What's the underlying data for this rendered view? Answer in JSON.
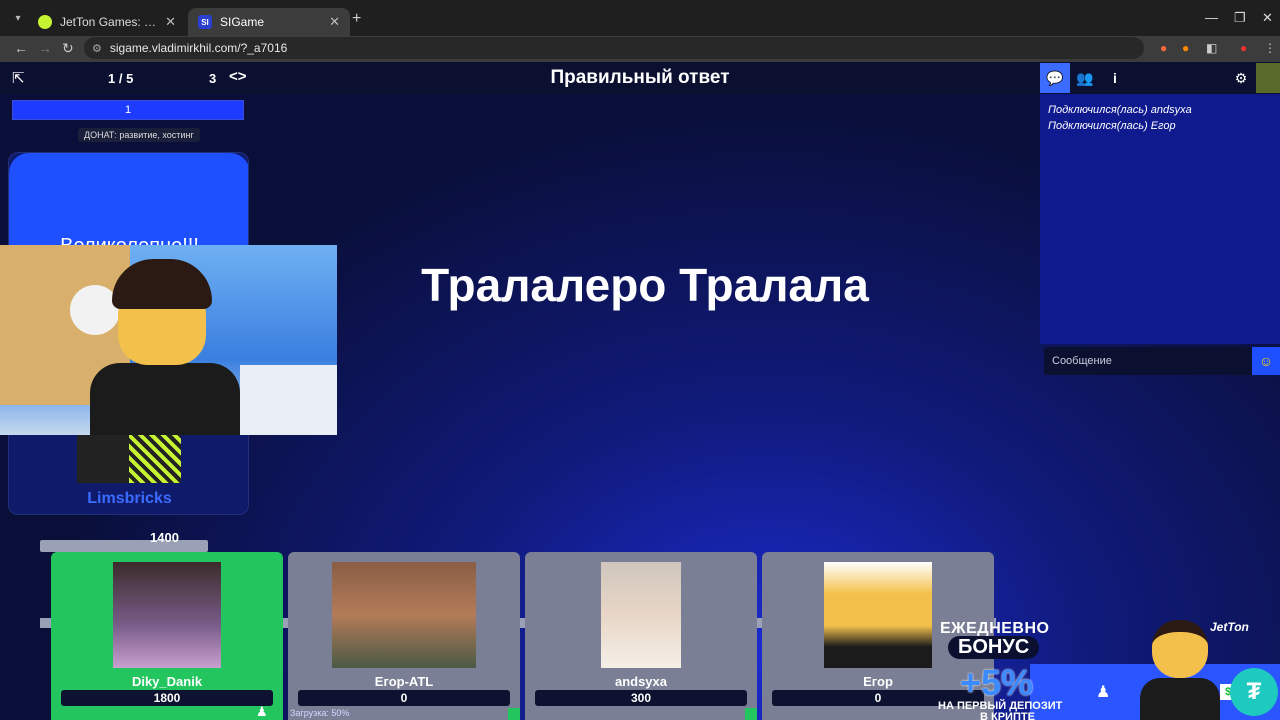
{
  "browser": {
    "tabs": [
      {
        "title": "JetTon Games: Погружение в",
        "active": false
      },
      {
        "title": "SIGame",
        "active": true
      }
    ],
    "url": "sigame.vladimirkhil.com/?_a7016"
  },
  "game": {
    "round_progress": "1 / 5",
    "round_count": "3",
    "stage_title": "Правильный ответ",
    "timer_value": "1",
    "donate_label": "ДОНАТ: развитие, хостинг",
    "showman_phrase": "Великолепно!!!",
    "showman_name": "Limsbricks",
    "answer": "Тралалеро Тралала",
    "stake": "1400",
    "loading_note": "Загрузка: 50%",
    "players": [
      {
        "name": "Diky_Danik",
        "score": "1800",
        "active": true
      },
      {
        "name": "Егор-ATL",
        "score": "0",
        "active": false
      },
      {
        "name": "andsyxa",
        "score": "300",
        "active": false
      },
      {
        "name": "Егор",
        "score": "0",
        "active": false
      }
    ]
  },
  "chat": {
    "log": [
      "Подключился(лась) andsyxa",
      "Подключился(лась) Егор"
    ],
    "placeholder": "Сообщение"
  },
  "ad": {
    "line1": "ЕЖЕДНЕВНО",
    "line2": "БОНУС",
    "line3": "+5%",
    "line4": "НА ПЕРВЫЙ ДЕПОЗИТ",
    "line5": "В КРИПТЕ",
    "brand": "JetTon"
  },
  "colors": {
    "accent": "#1e50ff",
    "active_player": "#22c55e",
    "background": "#0a0f3a"
  }
}
